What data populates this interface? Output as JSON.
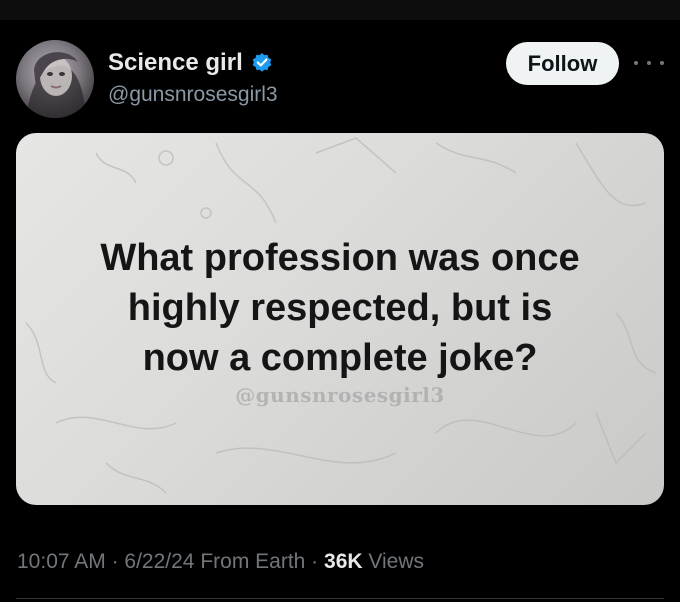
{
  "author": {
    "display_name": "Science girl",
    "handle": "@gunsnrosesgirl3",
    "verified": true,
    "avatar_icon": "profile-photo"
  },
  "actions": {
    "follow_label": "Follow",
    "more_icon": "ellipsis-icon"
  },
  "media": {
    "question": "What profession was once\nhighly respected, but is\nnow a complete joke?",
    "watermark": "@gunsnrosesgirl3"
  },
  "meta": {
    "time": "10:07 AM",
    "sep1": " · ",
    "date": "6/22/24",
    "source": " From Earth",
    "sep2": " · ",
    "views_count": "36K",
    "views_label": " Views"
  },
  "colors": {
    "background": "#000000",
    "text_primary": "#e7e9ea",
    "text_secondary": "#71767b",
    "verified_badge": "#1d9bf0",
    "follow_bg": "#eff3f4"
  }
}
